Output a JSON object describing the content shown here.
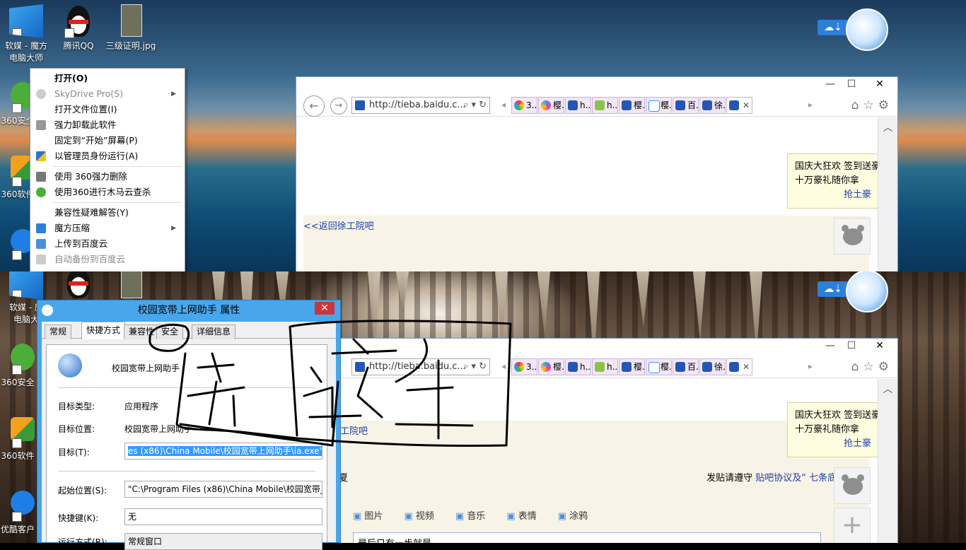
{
  "top": {
    "desktop_icons": [
      {
        "label": "软媒 - 魔方\n电脑大师",
        "line1": "软媒 - 魔方",
        "line2": "电脑大师"
      },
      {
        "label": "腾讯QQ"
      },
      {
        "label": "三级证明.jpg"
      },
      {
        "label": "360安全"
      },
      {
        "label": "360软件"
      }
    ],
    "context_menu": {
      "items": [
        {
          "label": "打开(O)"
        },
        {
          "label": "SkyDrive Pro(S)"
        },
        {
          "label": "打开文件位置(I)"
        },
        {
          "label": "强力卸载此软件"
        },
        {
          "label": "固定到“开始”屏幕(P)"
        },
        {
          "label": "以管理员身份运行(A)"
        },
        {
          "label": "使用 360强力删除"
        },
        {
          "label": "使用360进行木马云查杀"
        },
        {
          "label": "兼容性疑难解答(Y)"
        },
        {
          "label": "魔方压缩"
        },
        {
          "label": "上传到百度云"
        },
        {
          "label": "自动备份到百度云"
        }
      ]
    },
    "browser": {
      "address": "http://tieba.baidu.c...",
      "tabs": [
        "3...",
        "樱...",
        "h...",
        "h...",
        "樱...",
        "樱...",
        "百...",
        "徐...",
        ""
      ],
      "popup_line1": "国庆大狂欢  签到送豪",
      "popup_line2": "十万豪礼随你拿",
      "popup_link": "抢土豪",
      "back_link": "<<返回徐工院吧"
    }
  },
  "bottom": {
    "desktop_icons": [
      {
        "line1": "软媒 - 魔",
        "line2": "电脑大"
      },
      {
        "label": "360安全"
      },
      {
        "label": "360软件"
      },
      {
        "label": "优酷客户"
      }
    ],
    "dialog": {
      "title": "校园宽带上网助手 属性",
      "tabs": [
        "常规",
        "快捷方式",
        "兼容性",
        "安全",
        "详细信息"
      ],
      "app_name": "校园宽带上网助手",
      "target_type_label": "目标类型:",
      "target_type_value": "应用程序",
      "target_loc_label": "目标位置:",
      "target_loc_value": "校园宽带上网助手",
      "target_label": "目标(T):",
      "target_value": "es (x86)\\China Mobile\\校园宽带上网助手\\ia.exe\"",
      "start_label": "起始位置(S):",
      "start_value": "\"C:\\Program Files (x86)\\China Mobile\\校园宽带_",
      "hotkey_label": "快捷键(K):",
      "hotkey_value": "无",
      "run_label": "运行方式(R):",
      "run_value": "常规窗口"
    },
    "browser": {
      "address": "http://tieba.baidu.c...",
      "tabs": [
        "3...",
        "樱...",
        "h...",
        "h...",
        "樱...",
        "樱...",
        "百...",
        "徐...",
        ""
      ],
      "popup_line1": "国庆大狂欢  签到送豪",
      "popup_line2": "十万豪礼随你拿",
      "popup_link": "抢土豪",
      "back_link": "工院吧",
      "left_char": "夏",
      "rules_text": "发贴请遵守",
      "rules_link": "贴吧协议及",
      "rules_link2": "“ 七条底线 ”",
      "media": [
        "图片",
        "视频",
        "音乐",
        "表情",
        "涂鸦"
      ],
      "editor_text": "最后只有一步就是"
    }
  },
  "colors": {
    "dialog_accent": "#49a6ea",
    "link": "#1a3caa",
    "close_red": "#c7383a"
  }
}
